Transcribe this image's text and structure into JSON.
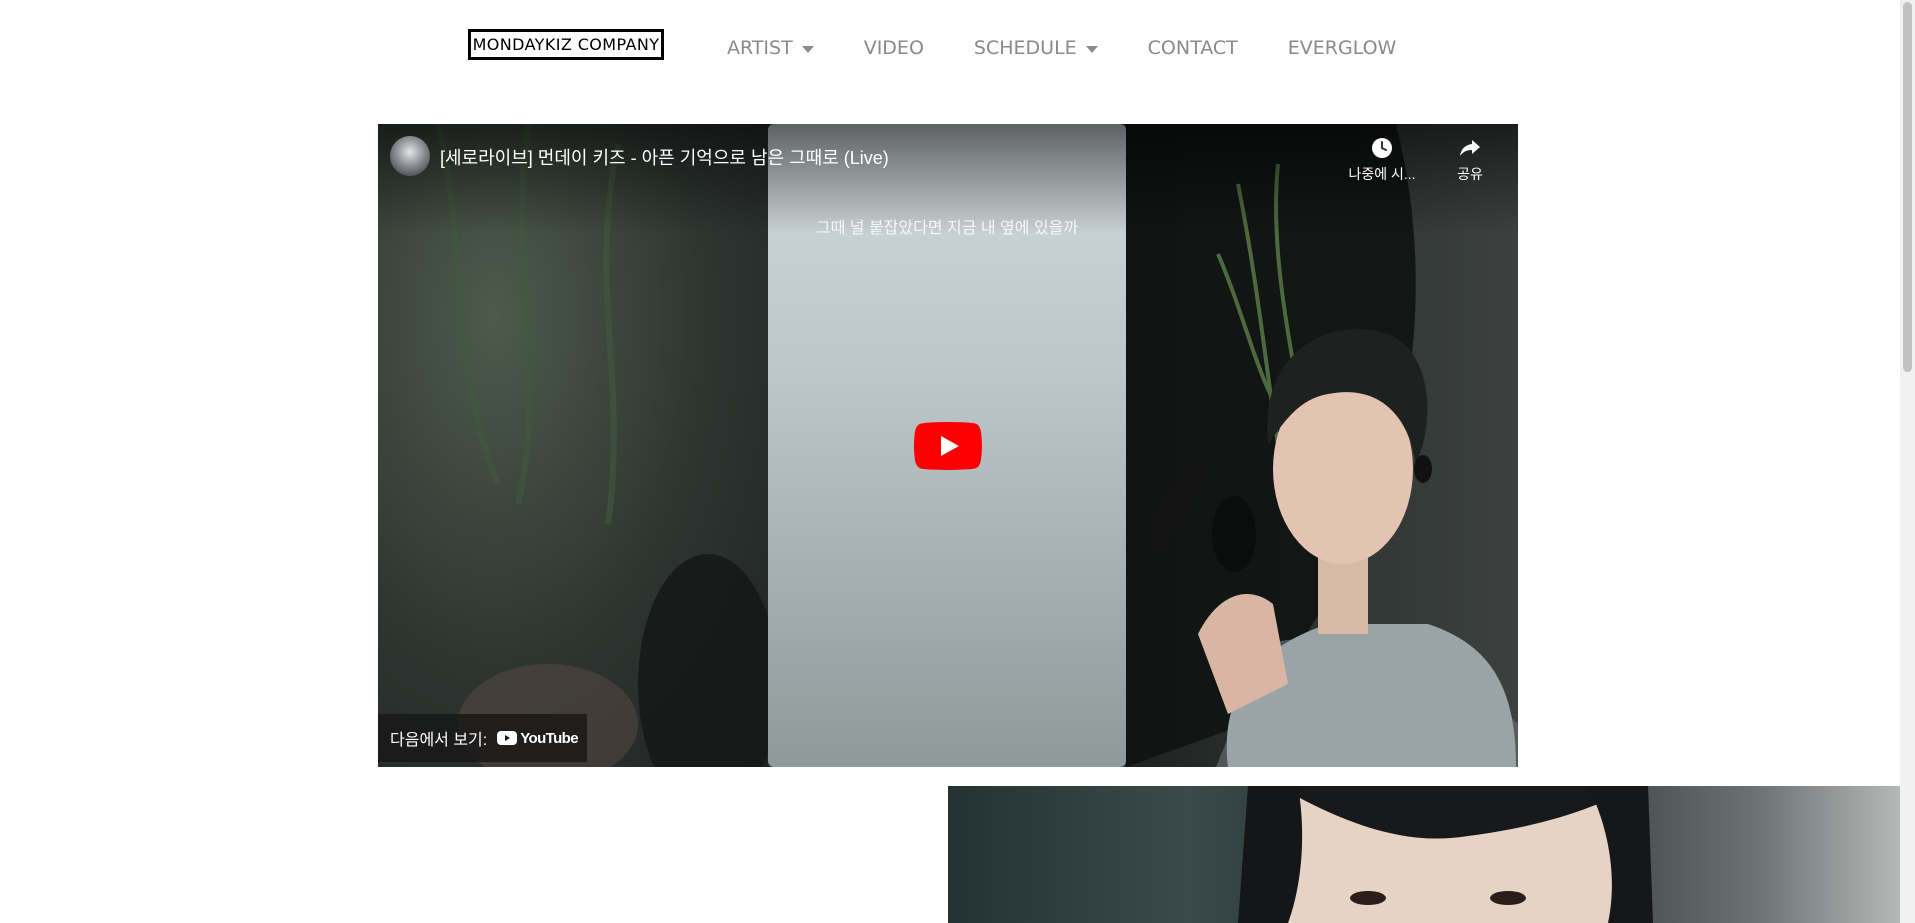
{
  "header": {
    "logo": "MONDAYKIZ COMPANY",
    "nav": [
      {
        "label": "ARTIST",
        "has_dropdown": true
      },
      {
        "label": "VIDEO",
        "has_dropdown": false
      },
      {
        "label": "SCHEDULE",
        "has_dropdown": true
      },
      {
        "label": "CONTACT",
        "has_dropdown": false
      },
      {
        "label": "EVERGLOW",
        "has_dropdown": false
      }
    ]
  },
  "video": {
    "title": "[세로라이브] 먼데이 키즈 - 아픈 기억으로 남은 그때로 (Live)",
    "subtitle": "그때 널 붙잡았다면 지금 내 옆에 있을까",
    "watch_later_label": "나중에 시...",
    "share_label": "공유",
    "watch_on_label": "다음에서 보기:",
    "youtube_label": "YouTube",
    "icons": [
      "clock-icon",
      "share-icon",
      "play-icon",
      "youtube-logo-icon"
    ],
    "colors": {
      "play_button": "#ff0000",
      "overlay": "#171717"
    }
  },
  "colors": {
    "nav_text": "#8a8a8a",
    "logo_border": "#000000"
  }
}
